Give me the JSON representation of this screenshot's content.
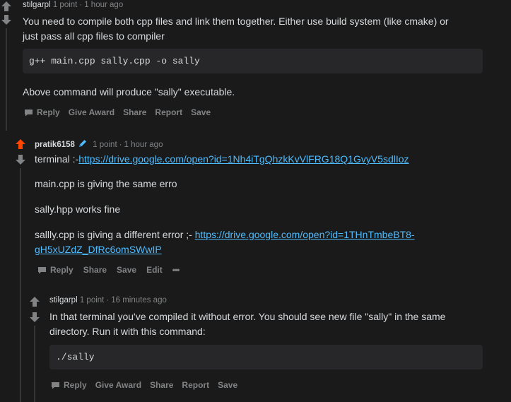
{
  "comments": [
    {
      "author": "stilgarpl",
      "points": "1 point",
      "time": "1 hour ago",
      "paragraphs": [
        "You need to compile both cpp files and link them together. Either use build system (like cmake) or",
        "just pass all cpp files to compiler"
      ],
      "code": "g++ main.cpp sally.cpp -o sally",
      "after": "Above command will produce \"sally\" executable.",
      "actions": {
        "reply": "Reply",
        "award": "Give Award",
        "share": "Share",
        "report": "Report",
        "save": "Save"
      }
    },
    {
      "author": "pratik6158",
      "points": "1 point",
      "time": "1 hour ago",
      "line1_prefix": "terminal :-",
      "line1_link": "https://drive.google.com/open?id=1Nh4iTgQhzkKvVlFRG18Q1GvyV5sdlIoz",
      "p2": "main.cpp is giving the same erro",
      "p3": "sally.hpp works fine",
      "p4_prefix": "sallly.cpp is giving a different error ;- ",
      "p4_link_a": "https://drive.google.com/open?id=1THnTmbeBT8-",
      "p4_link_b": "gH5xUZdZ_DfRc6omSWwIP",
      "actions": {
        "reply": "Reply",
        "share": "Share",
        "save": "Save",
        "edit": "Edit",
        "more": "•••"
      }
    },
    {
      "author": "stilgarpl",
      "points": "1 point",
      "time": "16 minutes ago",
      "paragraphs": [
        "In that terminal you've compiled it without error. You should see new file \"sally\" in the same",
        "directory. Run it with this command:"
      ],
      "code": "./sally",
      "actions": {
        "reply": "Reply",
        "award": "Give Award",
        "share": "Share",
        "report": "Report",
        "save": "Save"
      }
    }
  ],
  "colors": {
    "upvoted": "#ff4500",
    "link": "#4fbcff",
    "muted": "#818384"
  }
}
